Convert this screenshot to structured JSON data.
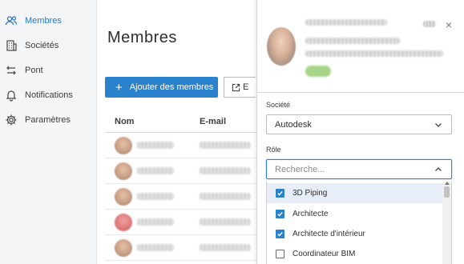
{
  "sidebar": {
    "items": [
      {
        "label": "Membres",
        "icon": "users-icon",
        "active": true
      },
      {
        "label": "Sociétés",
        "icon": "building-icon",
        "active": false
      },
      {
        "label": "Pont",
        "icon": "bridge-arrows-icon",
        "active": false
      },
      {
        "label": "Notifications",
        "icon": "bell-icon",
        "active": false
      },
      {
        "label": "Paramètres",
        "icon": "gear-icon",
        "active": false
      }
    ]
  },
  "main": {
    "title": "Membres",
    "add_button": "Ajouter des membres",
    "export_button": "E",
    "columns": {
      "name": "Nom",
      "email": "E-mail"
    }
  },
  "panel": {
    "close": "×",
    "company_label": "Société",
    "company_value": "Autodesk",
    "role_label": "Rôle",
    "role_placeholder": "Recherche...",
    "roles": [
      {
        "label": "3D Piping",
        "checked": true
      },
      {
        "label": "Architecte",
        "checked": true
      },
      {
        "label": "Architecte d'intérieur",
        "checked": true
      },
      {
        "label": "Coordinateur BIM",
        "checked": false
      }
    ]
  },
  "colors": {
    "accent": "#2b82cc",
    "active_nav": "#2b77c4",
    "highlight": "#e7eef7"
  }
}
